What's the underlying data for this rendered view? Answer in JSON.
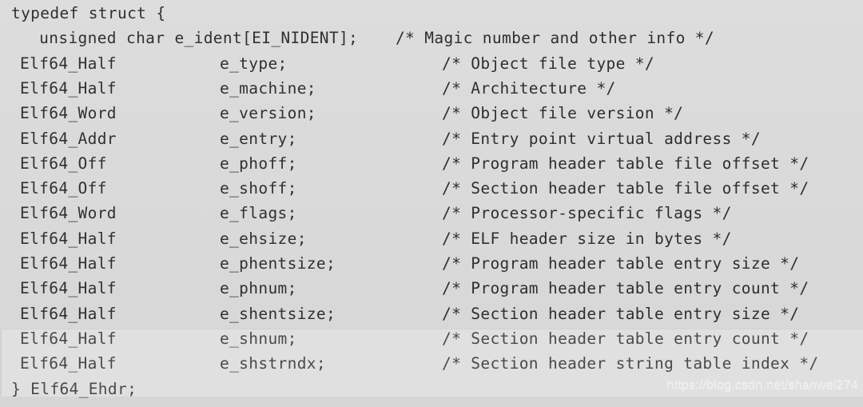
{
  "document": {
    "language": "C",
    "background_color": "#dcdcdc",
    "text_color": "#2c2c2c",
    "struct_name": "Elf64_Ehdr",
    "opening_line": "typedef struct {",
    "closing_line": "} Elf64_Ehdr;"
  },
  "watermark": {
    "text": "https://blog.csdn.net/shanwei274",
    "color": "#efefef"
  },
  "code_lines": [
    {
      "index": 0,
      "kind": "open",
      "text": "typedef struct {",
      "type": "",
      "name": "",
      "comment": ""
    },
    {
      "index": 1,
      "kind": "field-inline",
      "text": "  unsigned char e_ident[EI_NIDENT];",
      "type": "unsigned char",
      "name": "e_ident[EI_NIDENT];",
      "comment": "/* Magic number and other info */"
    },
    {
      "index": 2,
      "kind": "field",
      "type": "Elf64_Half",
      "name": "e_type;",
      "comment": "/* Object file type */"
    },
    {
      "index": 3,
      "kind": "field",
      "type": "Elf64_Half",
      "name": "e_machine;",
      "comment": "/* Architecture */"
    },
    {
      "index": 4,
      "kind": "field",
      "type": "Elf64_Word",
      "name": "e_version;",
      "comment": "/* Object file version */"
    },
    {
      "index": 5,
      "kind": "field",
      "type": "Elf64_Addr",
      "name": "e_entry;",
      "comment": "/* Entry point virtual address */"
    },
    {
      "index": 6,
      "kind": "field",
      "type": "Elf64_Off",
      "name": "e_phoff;",
      "comment": "/* Program header table file offset */"
    },
    {
      "index": 7,
      "kind": "field",
      "type": "Elf64_Off",
      "name": "e_shoff;",
      "comment": "/* Section header table file offset */"
    },
    {
      "index": 8,
      "kind": "field",
      "type": "Elf64_Word",
      "name": "e_flags;",
      "comment": "/* Processor-specific flags */"
    },
    {
      "index": 9,
      "kind": "field",
      "type": "Elf64_Half",
      "name": "e_ehsize;",
      "comment": "/* ELF header size in bytes */"
    },
    {
      "index": 10,
      "kind": "field",
      "type": "Elf64_Half",
      "name": "e_phentsize;",
      "comment": "/* Program header table entry size */"
    },
    {
      "index": 11,
      "kind": "field",
      "type": "Elf64_Half",
      "name": "e_phnum;",
      "comment": "/* Program header table entry count */"
    },
    {
      "index": 12,
      "kind": "field",
      "type": "Elf64_Half",
      "name": "e_shentsize;",
      "comment": "/* Section header table entry size */"
    },
    {
      "index": 13,
      "kind": "field",
      "type": "Elf64_Half",
      "name": "e_shnum;",
      "comment": "/* Section header table entry count */"
    },
    {
      "index": 14,
      "kind": "field",
      "type": "Elf64_Half",
      "name": "e_shstrndx;",
      "comment": "/* Section header string table index */"
    },
    {
      "index": 15,
      "kind": "close",
      "text": "} Elf64_Ehdr;",
      "type": "",
      "name": "",
      "comment": ""
    }
  ]
}
